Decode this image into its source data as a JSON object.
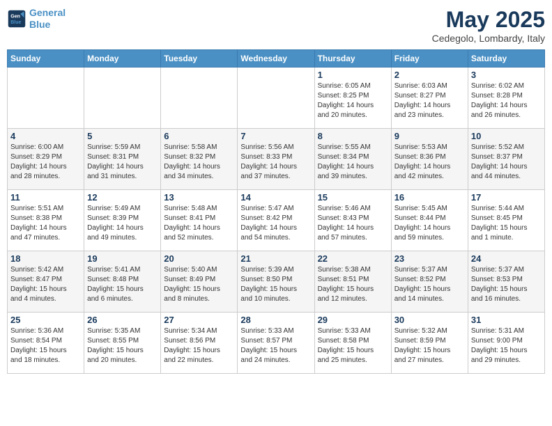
{
  "header": {
    "logo_line1": "General",
    "logo_line2": "Blue",
    "month": "May 2025",
    "location": "Cedegolo, Lombardy, Italy"
  },
  "weekdays": [
    "Sunday",
    "Monday",
    "Tuesday",
    "Wednesday",
    "Thursday",
    "Friday",
    "Saturday"
  ],
  "weeks": [
    [
      {
        "day": "",
        "detail": ""
      },
      {
        "day": "",
        "detail": ""
      },
      {
        "day": "",
        "detail": ""
      },
      {
        "day": "",
        "detail": ""
      },
      {
        "day": "1",
        "detail": "Sunrise: 6:05 AM\nSunset: 8:25 PM\nDaylight: 14 hours\nand 20 minutes."
      },
      {
        "day": "2",
        "detail": "Sunrise: 6:03 AM\nSunset: 8:27 PM\nDaylight: 14 hours\nand 23 minutes."
      },
      {
        "day": "3",
        "detail": "Sunrise: 6:02 AM\nSunset: 8:28 PM\nDaylight: 14 hours\nand 26 minutes."
      }
    ],
    [
      {
        "day": "4",
        "detail": "Sunrise: 6:00 AM\nSunset: 8:29 PM\nDaylight: 14 hours\nand 28 minutes."
      },
      {
        "day": "5",
        "detail": "Sunrise: 5:59 AM\nSunset: 8:31 PM\nDaylight: 14 hours\nand 31 minutes."
      },
      {
        "day": "6",
        "detail": "Sunrise: 5:58 AM\nSunset: 8:32 PM\nDaylight: 14 hours\nand 34 minutes."
      },
      {
        "day": "7",
        "detail": "Sunrise: 5:56 AM\nSunset: 8:33 PM\nDaylight: 14 hours\nand 37 minutes."
      },
      {
        "day": "8",
        "detail": "Sunrise: 5:55 AM\nSunset: 8:34 PM\nDaylight: 14 hours\nand 39 minutes."
      },
      {
        "day": "9",
        "detail": "Sunrise: 5:53 AM\nSunset: 8:36 PM\nDaylight: 14 hours\nand 42 minutes."
      },
      {
        "day": "10",
        "detail": "Sunrise: 5:52 AM\nSunset: 8:37 PM\nDaylight: 14 hours\nand 44 minutes."
      }
    ],
    [
      {
        "day": "11",
        "detail": "Sunrise: 5:51 AM\nSunset: 8:38 PM\nDaylight: 14 hours\nand 47 minutes."
      },
      {
        "day": "12",
        "detail": "Sunrise: 5:49 AM\nSunset: 8:39 PM\nDaylight: 14 hours\nand 49 minutes."
      },
      {
        "day": "13",
        "detail": "Sunrise: 5:48 AM\nSunset: 8:41 PM\nDaylight: 14 hours\nand 52 minutes."
      },
      {
        "day": "14",
        "detail": "Sunrise: 5:47 AM\nSunset: 8:42 PM\nDaylight: 14 hours\nand 54 minutes."
      },
      {
        "day": "15",
        "detail": "Sunrise: 5:46 AM\nSunset: 8:43 PM\nDaylight: 14 hours\nand 57 minutes."
      },
      {
        "day": "16",
        "detail": "Sunrise: 5:45 AM\nSunset: 8:44 PM\nDaylight: 14 hours\nand 59 minutes."
      },
      {
        "day": "17",
        "detail": "Sunrise: 5:44 AM\nSunset: 8:45 PM\nDaylight: 15 hours\nand 1 minute."
      }
    ],
    [
      {
        "day": "18",
        "detail": "Sunrise: 5:42 AM\nSunset: 8:47 PM\nDaylight: 15 hours\nand 4 minutes."
      },
      {
        "day": "19",
        "detail": "Sunrise: 5:41 AM\nSunset: 8:48 PM\nDaylight: 15 hours\nand 6 minutes."
      },
      {
        "day": "20",
        "detail": "Sunrise: 5:40 AM\nSunset: 8:49 PM\nDaylight: 15 hours\nand 8 minutes."
      },
      {
        "day": "21",
        "detail": "Sunrise: 5:39 AM\nSunset: 8:50 PM\nDaylight: 15 hours\nand 10 minutes."
      },
      {
        "day": "22",
        "detail": "Sunrise: 5:38 AM\nSunset: 8:51 PM\nDaylight: 15 hours\nand 12 minutes."
      },
      {
        "day": "23",
        "detail": "Sunrise: 5:37 AM\nSunset: 8:52 PM\nDaylight: 15 hours\nand 14 minutes."
      },
      {
        "day": "24",
        "detail": "Sunrise: 5:37 AM\nSunset: 8:53 PM\nDaylight: 15 hours\nand 16 minutes."
      }
    ],
    [
      {
        "day": "25",
        "detail": "Sunrise: 5:36 AM\nSunset: 8:54 PM\nDaylight: 15 hours\nand 18 minutes."
      },
      {
        "day": "26",
        "detail": "Sunrise: 5:35 AM\nSunset: 8:55 PM\nDaylight: 15 hours\nand 20 minutes."
      },
      {
        "day": "27",
        "detail": "Sunrise: 5:34 AM\nSunset: 8:56 PM\nDaylight: 15 hours\nand 22 minutes."
      },
      {
        "day": "28",
        "detail": "Sunrise: 5:33 AM\nSunset: 8:57 PM\nDaylight: 15 hours\nand 24 minutes."
      },
      {
        "day": "29",
        "detail": "Sunrise: 5:33 AM\nSunset: 8:58 PM\nDaylight: 15 hours\nand 25 minutes."
      },
      {
        "day": "30",
        "detail": "Sunrise: 5:32 AM\nSunset: 8:59 PM\nDaylight: 15 hours\nand 27 minutes."
      },
      {
        "day": "31",
        "detail": "Sunrise: 5:31 AM\nSunset: 9:00 PM\nDaylight: 15 hours\nand 29 minutes."
      }
    ]
  ]
}
